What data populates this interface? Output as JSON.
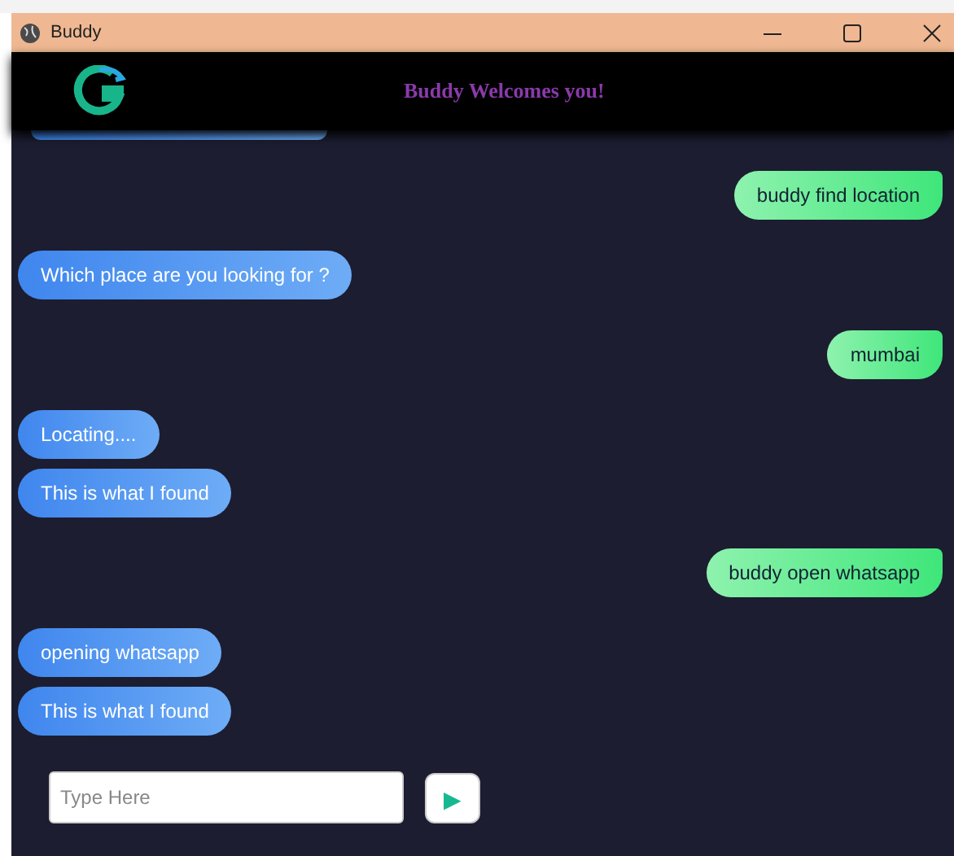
{
  "window": {
    "title": "Buddy"
  },
  "header": {
    "title": "Buddy Welcomes you!"
  },
  "messages": [
    {
      "kind": "received_clipped"
    },
    {
      "kind": "sent",
      "text": "buddy find location"
    },
    {
      "kind": "received",
      "text": "Which place are you looking for ?"
    },
    {
      "kind": "sent",
      "text": "mumbai"
    },
    {
      "kind": "received",
      "text": "Locating...."
    },
    {
      "kind": "received",
      "text": "This is what I found"
    },
    {
      "kind": "sent",
      "text": "buddy open whatsapp"
    },
    {
      "kind": "received",
      "text": "opening whatsapp"
    },
    {
      "kind": "received",
      "text": "This is what I found"
    }
  ],
  "composer": {
    "placeholder": "Type Here",
    "send": "▶"
  }
}
